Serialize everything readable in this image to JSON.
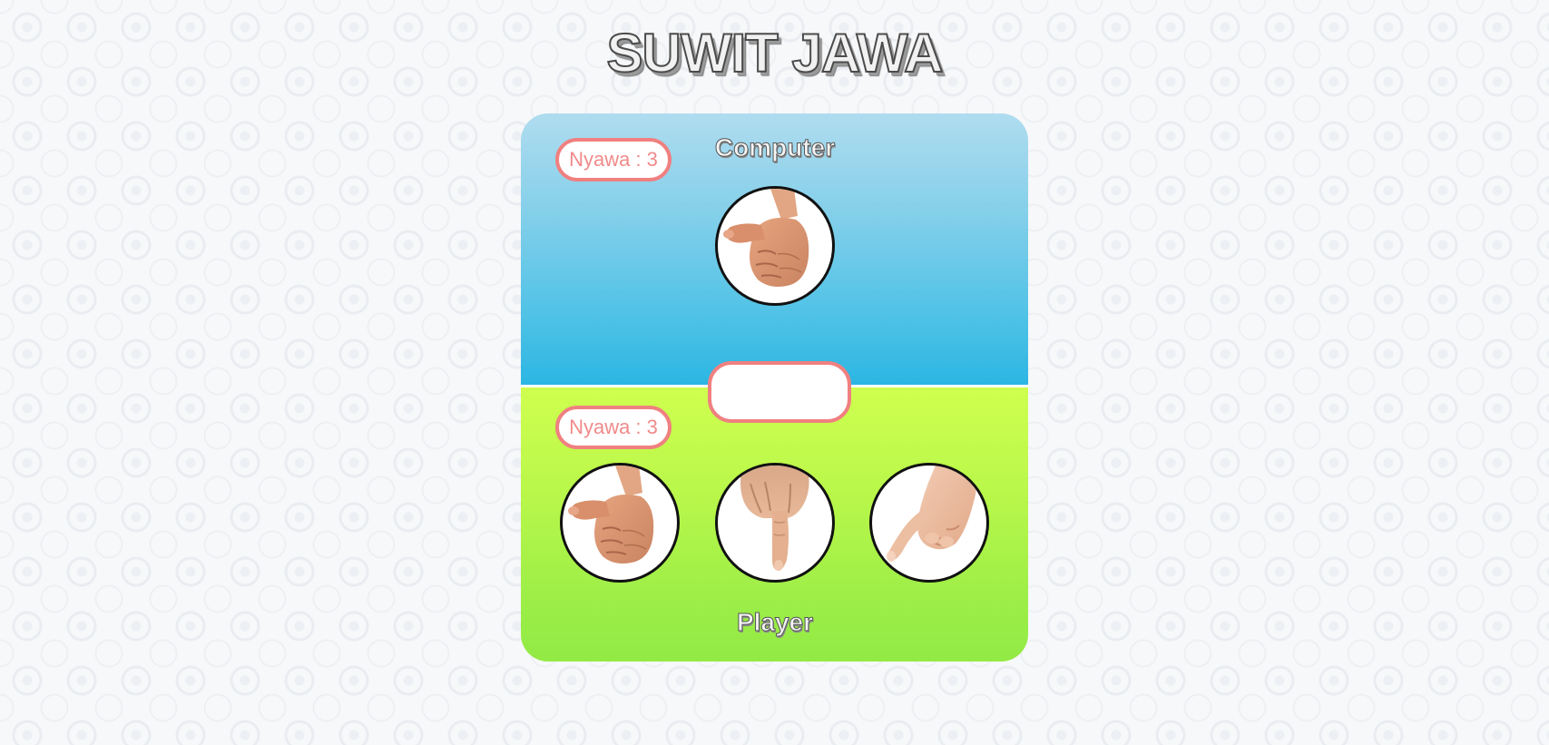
{
  "game": {
    "title": "SUWIT JAWA"
  },
  "computer": {
    "label": "Computer",
    "lives": "Nyawa : 3",
    "current_hand": "gajah-thumb-hand-icon"
  },
  "result": {
    "text": ""
  },
  "player": {
    "label": "Player",
    "lives": "Nyawa : 3",
    "choices": [
      {
        "name": "gajah",
        "icon": "gajah-thumb-hand-icon"
      },
      {
        "name": "orang",
        "icon": "orang-index-finger-hand-icon"
      },
      {
        "name": "semut",
        "icon": "semut-little-finger-hand-icon"
      }
    ]
  },
  "colors": {
    "computer_bg": "#2cb6e3",
    "player_bg": "#9bed47",
    "badge_border": "#f08080",
    "badge_text": "#f08a8a"
  }
}
